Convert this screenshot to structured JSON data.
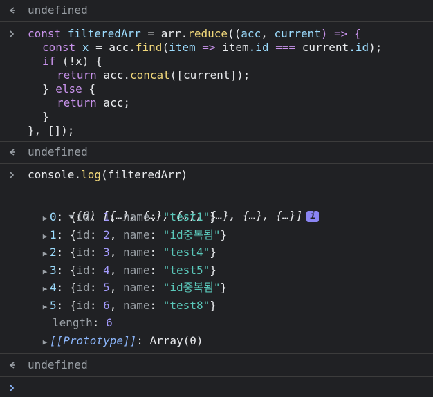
{
  "outputs": {
    "undefined1": "undefined",
    "undefined2": "undefined",
    "undefined3": "undefined"
  },
  "code": {
    "l1": {
      "kw": "const",
      "v": "filteredArr",
      "eq": " = ",
      "obj": "arr",
      "dot": ".",
      "fn": "reduce",
      "open": "((",
      "a1": "acc",
      "comma": ", ",
      "a2": "current",
      "arrow": ") => {"
    },
    "l2": {
      "kw": "const",
      "v": "x",
      "eq": " = ",
      "obj": "acc",
      "dot": ".",
      "fn": "find",
      "open": "(",
      "p": "item",
      "arrow": " => ",
      "o2": "item",
      "prop": ".id",
      "op": " === ",
      "o3": "current",
      "prop2": ".id",
      "close": ");"
    },
    "l3": {
      "kw": "if",
      "rest": " (!x) {"
    },
    "l4": {
      "kw": "return",
      "obj": " acc",
      "dot": ".",
      "fn": "concat",
      "rest": "([current]);"
    },
    "l5": {
      "text1": "} ",
      "kw": "else",
      "text2": " {"
    },
    "l6": {
      "kw": "return",
      "rest": " acc;"
    },
    "l7": {
      "text": "}"
    },
    "l8": {
      "text": "}, []);"
    }
  },
  "log_cmd": {
    "obj": "console",
    "dot": ".",
    "fn": "log",
    "rest": "(filteredArr)"
  },
  "array_summary": {
    "count": "(6)",
    "preview": "[{…}, {…}, {…}, {…}, {…}, {…}]",
    "badge": "i"
  },
  "items": [
    {
      "idx": "0",
      "id": "1",
      "name": "\"test1\""
    },
    {
      "idx": "1",
      "id": "2",
      "name": "\"id중복됨\""
    },
    {
      "idx": "2",
      "id": "3",
      "name": "\"test4\""
    },
    {
      "idx": "3",
      "id": "4",
      "name": "\"test5\""
    },
    {
      "idx": "4",
      "id": "5",
      "name": "\"id중복됨\""
    },
    {
      "idx": "5",
      "id": "6",
      "name": "\"test8\""
    }
  ],
  "length": {
    "key": "length",
    "value": "6"
  },
  "prototype": {
    "key": "[[Prototype]]",
    "value": "Array(0)"
  },
  "colors": {
    "background": "#202124",
    "string": "#5ac8ba",
    "number": "#a49bfd",
    "keyword": "#c792ea",
    "function": "#f0d77a"
  }
}
